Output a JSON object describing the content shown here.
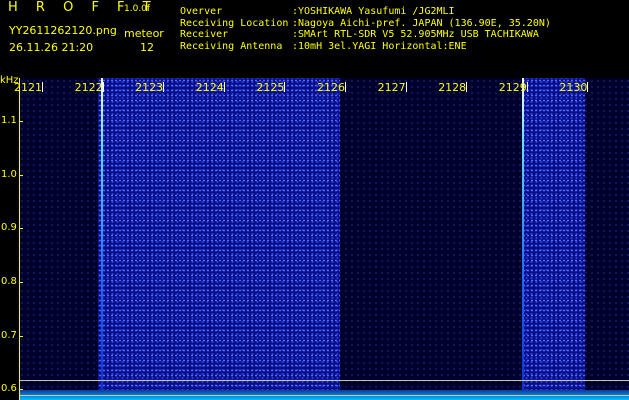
{
  "header": {
    "brand": "H R O F F T",
    "version": "1.0.0f",
    "filename": "YY2611262120.png",
    "datetime": "26.11.26 21:20",
    "meteor_label": "meteor",
    "meteor_count": "12"
  },
  "info": [
    {
      "key": "Overver",
      "value": ":YOSHIKAWA Yasufumi /JG2MLI"
    },
    {
      "key": "Receiving Location",
      "value": ":Nagoya Aichi-pref. JAPAN (136.90E, 35.20N)"
    },
    {
      "key": "Receiver",
      "value": ":SMArt RTL-SDR V5 52.905MHz USB TACHIKAWA"
    },
    {
      "key": "Receiving Antenna",
      "value": ":10mH 3el.YAGI Horizontal:ENE"
    }
  ],
  "plot": {
    "y_unit": "kHz",
    "y_labels": [
      "1.1",
      "1.0",
      "0.9",
      "0.8",
      "0.7",
      "0.6"
    ],
    "y_values": [
      1.1,
      1.0,
      0.9,
      0.8,
      0.7,
      0.6
    ],
    "y_range": [
      0.58,
      1.18
    ],
    "x_labels": [
      "2121",
      "2122",
      "2123",
      "2124",
      "2125",
      "2126",
      "2127",
      "2128",
      "2129",
      "2130"
    ],
    "x_range": [
      2120,
      2130
    ],
    "bright_bands": [
      [
        2121.95,
        2125.95
      ],
      [
        2128.95,
        2130
      ]
    ],
    "echo_times": [
      2122.0,
      2128.95
    ]
  },
  "colors": {
    "label": "#ffff00",
    "background": "#000000",
    "bright_band": "#0a0e86",
    "dark_band": "#00002c"
  }
}
